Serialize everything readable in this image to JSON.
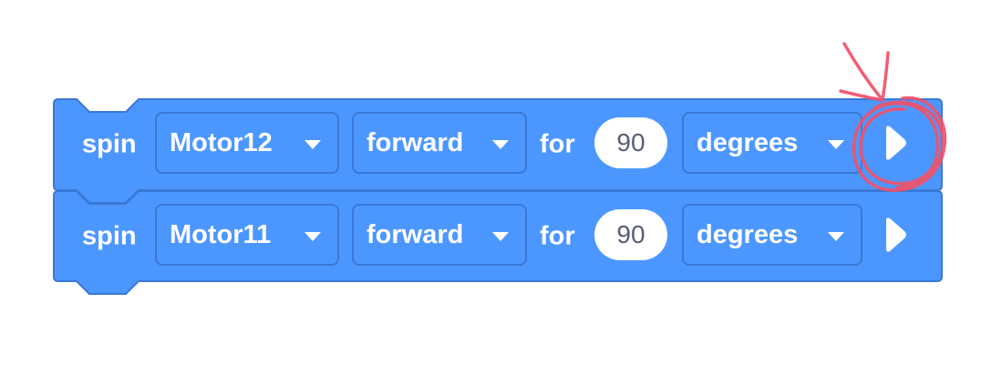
{
  "blocks": [
    {
      "verb": "spin",
      "motor": "Motor12",
      "direction": "forward",
      "for_label": "for",
      "amount": "90",
      "unit": "degrees"
    },
    {
      "verb": "spin",
      "motor": "Motor11",
      "direction": "forward",
      "for_label": "for",
      "amount": "90",
      "unit": "degrees"
    }
  ],
  "colors": {
    "block_fill": "#4c97ff",
    "block_border": "#3a78d6",
    "annotation": "#f0526a"
  },
  "icons": [
    "play-icon",
    "dropdown-caret-icon"
  ]
}
